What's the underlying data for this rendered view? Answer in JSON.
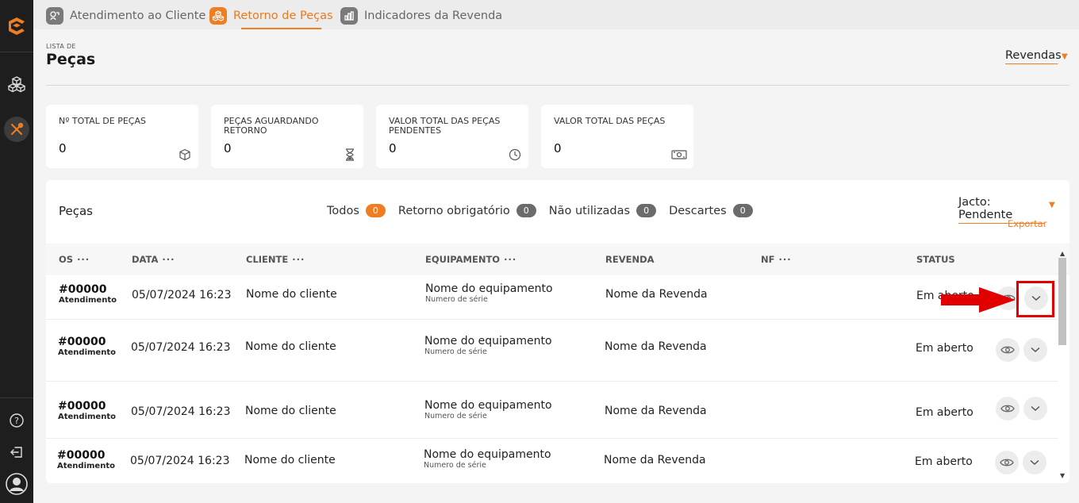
{
  "tabs": [
    {
      "label": "Atendimento ao Cliente",
      "active": false
    },
    {
      "label": "Retorno de Peças",
      "active": true
    },
    {
      "label": "Indicadores da Revenda",
      "active": false
    }
  ],
  "header": {
    "list_label": "LISTA DE",
    "title": "Peças",
    "revendas_label": "Revendas"
  },
  "cards": [
    {
      "label": "Nº TOTAL DE PEÇAS",
      "value": "0",
      "icon": "box-icon"
    },
    {
      "label": "PEÇAS AGUARDANDO RETORNO",
      "value": "0",
      "icon": "hourglass-icon"
    },
    {
      "label": "VALOR TOTAL DAS PEÇAS PENDENTES",
      "value": "0",
      "icon": "clock-icon"
    },
    {
      "label": "VALOR TOTAL DAS PEÇAS",
      "value": "0",
      "icon": "money-icon"
    }
  ],
  "panel": {
    "title": "Peças",
    "filters": [
      {
        "label": "Todos",
        "count": "0",
        "active": true
      },
      {
        "label": "Retorno obrigatório",
        "count": "0",
        "active": false
      },
      {
        "label": "Não utilizadas",
        "count": "0",
        "active": false
      },
      {
        "label": "Descartes",
        "count": "0",
        "active": false
      }
    ],
    "status_filter": "Jacto: Pendente",
    "export_label": "Exportar"
  },
  "table": {
    "columns": [
      "OS",
      "DATA",
      "CLIENTE",
      "EQUIPAMENTO",
      "REVENDA",
      "NF",
      "STATUS"
    ],
    "rows": [
      {
        "os": "#00000",
        "os_type": "Atendimento",
        "date": "05/07/2024 16:23",
        "client": "Nome do cliente",
        "equipment": "Nome do equipamento",
        "serial": "Numero de série",
        "dealer": "Nome da Revenda",
        "nf": "",
        "status": "Em aberto"
      },
      {
        "os": "#00000",
        "os_type": "Atendimento",
        "date": "05/07/2024 16:23",
        "client": "Nome do cliente",
        "equipment": "Nome do equipamento",
        "serial": "Numero de série",
        "dealer": "Nome da Revenda",
        "nf": "",
        "status": "Em aberto"
      },
      {
        "os": "#00000",
        "os_type": "Atendimento",
        "date": "05/07/2024 16:23",
        "client": "Nome do cliente",
        "equipment": "Nome do equipamento",
        "serial": "Numero de série",
        "dealer": "Nome da Revenda",
        "nf": "",
        "status": "Em aberto"
      },
      {
        "os": "#00000",
        "os_type": "Atendimento",
        "date": "05/07/2024 16:23",
        "client": "Nome do cliente",
        "equipment": "Nome do equipamento",
        "serial": "Numero de série",
        "dealer": "Nome da Revenda",
        "nf": "",
        "status": "Em aberto"
      }
    ]
  },
  "colors": {
    "accent": "#ef7d22",
    "sidebar": "#1e1e1e",
    "annotation": "#e00000"
  }
}
